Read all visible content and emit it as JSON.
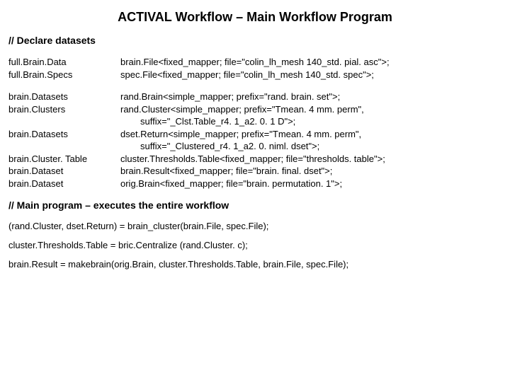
{
  "title": "ACTIVAL Workflow – Main Workflow Program",
  "section_declare": "// Declare datasets",
  "section_main": "// Main program – executes the entire workflow",
  "declarations": {
    "group1": {
      "left": [
        "full.Brain.Data",
        "full.Brain.Specs"
      ],
      "right": [
        "brain.File<fixed_mapper; file=\"colin_lh_mesh 140_std. pial. asc\">;",
        "spec.File<fixed_mapper; file=\"colin_lh_mesh 140_std. spec\">;"
      ]
    },
    "group2": {
      "left": [
        "brain.Datasets",
        "brain.Clusters",
        "",
        "brain.Datasets",
        "",
        "brain.Cluster. Table",
        "brain.Dataset",
        "brain.Dataset"
      ],
      "right_lines": [
        {
          "text": "rand.Brain<simple_mapper; prefix=\"rand. brain. set\">;",
          "cont": false
        },
        {
          "text": "rand.Cluster<simple_mapper; prefix=\"Tmean. 4 mm. perm\",",
          "cont": false
        },
        {
          "text": "suffix=\"_Clst.Table_r4. 1_a2. 0. 1 D\">;",
          "cont": true
        },
        {
          "text": "dset.Return<simple_mapper; prefix=\"Tmean. 4 mm. perm\",",
          "cont": false
        },
        {
          "text": "suffix=\"_Clustered_r4. 1_a2. 0. niml. dset\">;",
          "cont": true
        },
        {
          "text": "cluster.Thresholds.Table<fixed_mapper; file=\"thresholds. table\">;",
          "cont": false
        },
        {
          "text": " brain.Result<fixed_mapper; file=\"brain. final. dset\">;",
          "cont": false
        },
        {
          "text": " orig.Brain<fixed_mapper; file=\"brain. permutation. 1\">;",
          "cont": false
        }
      ]
    }
  },
  "main_program": [
    "(rand.Cluster, dset.Return) = brain_cluster(brain.File, spec.File);",
    "cluster.Thresholds.Table = bric.Centralize (rand.Cluster. c);",
    "brain.Result = makebrain(orig.Brain, cluster.Thresholds.Table, brain.File, spec.File);"
  ]
}
